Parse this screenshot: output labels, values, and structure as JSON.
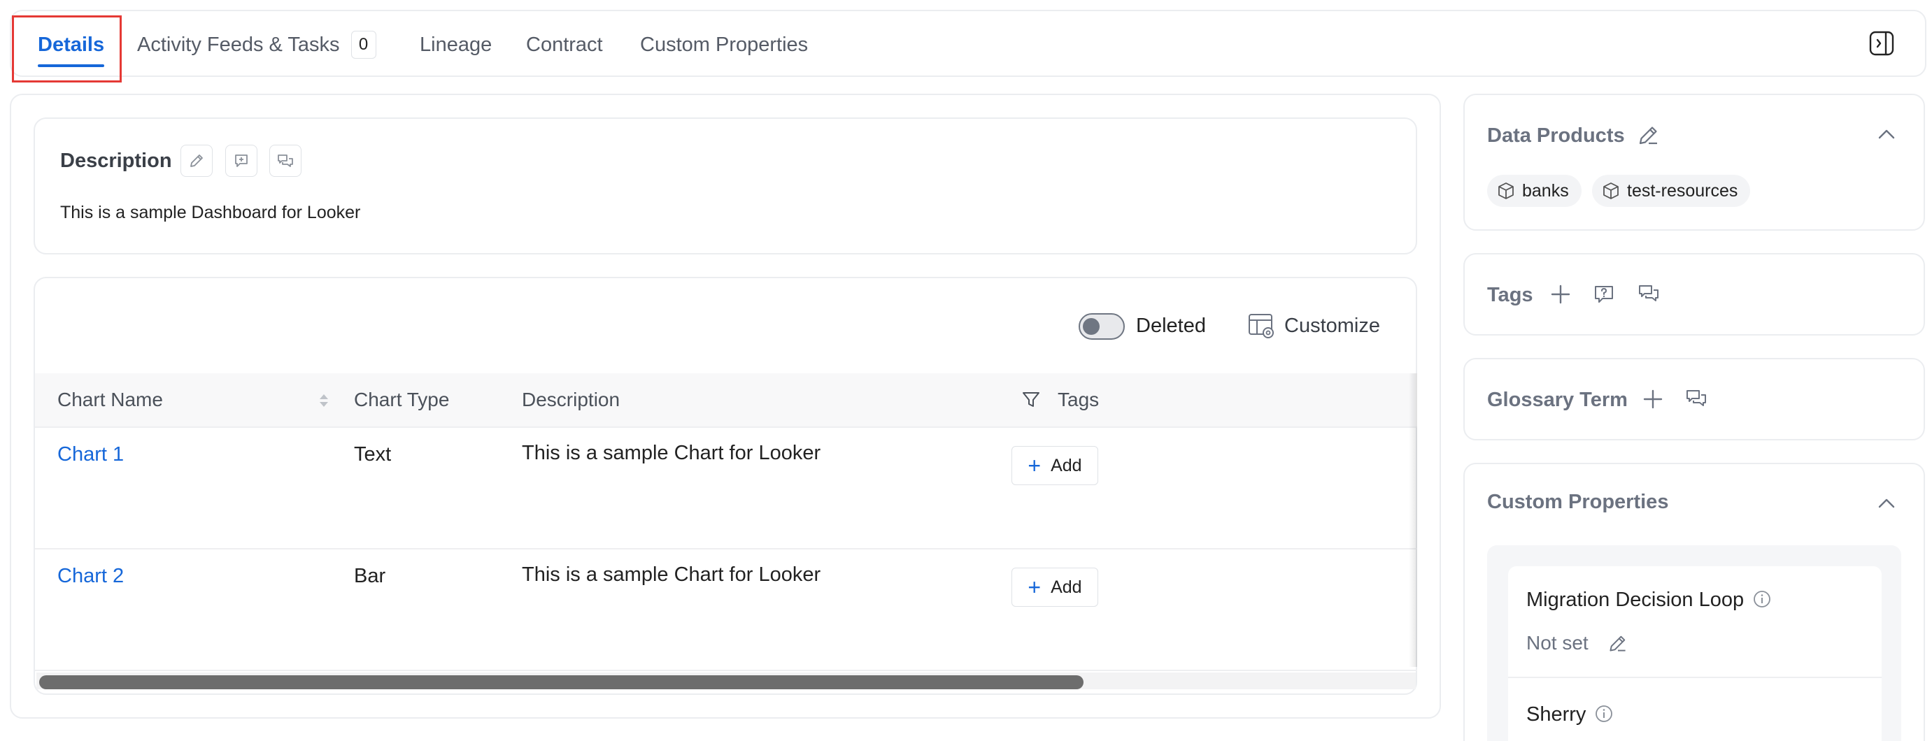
{
  "tabs": {
    "details": "Details",
    "activity": "Activity Feeds & Tasks",
    "activity_count": "0",
    "lineage": "Lineage",
    "contract": "Contract",
    "custom_properties": "Custom Properties"
  },
  "description": {
    "title": "Description",
    "text": "This is a sample Dashboard for Looker"
  },
  "table": {
    "deleted_label": "Deleted",
    "customize_label": "Customize",
    "deleted_toggle": false,
    "columns": {
      "name": "Chart Name",
      "type": "Chart Type",
      "description": "Description",
      "tags": "Tags"
    },
    "add_label": "Add",
    "rows": [
      {
        "name": "Chart 1",
        "type": "Text",
        "description": "This is a sample Chart for Looker"
      },
      {
        "name": "Chart 2",
        "type": "Bar",
        "description": "This is a sample Chart for Looker"
      }
    ],
    "scroll_fraction": 0.76
  },
  "sidebar": {
    "data_products": {
      "title": "Data Products",
      "items": [
        "banks",
        "test-resources"
      ]
    },
    "tags": {
      "title": "Tags"
    },
    "glossary": {
      "title": "Glossary Term"
    },
    "custom_properties": {
      "title": "Custom Properties",
      "items": [
        {
          "name": "Migration Decision Loop",
          "value": "Not set"
        },
        {
          "name": "Sherry"
        }
      ]
    }
  },
  "colors": {
    "accent": "#1667d9",
    "highlight": "#e53935",
    "text_muted": "#6b7280"
  },
  "icons": [
    "panel-toggle-icon",
    "pencil-icon",
    "request-icon",
    "conversation-icon",
    "toggle",
    "customize-icon",
    "sort-icon",
    "filter-icon",
    "plus-icon",
    "chevron-up-icon",
    "cube-icon",
    "info-icon"
  ]
}
